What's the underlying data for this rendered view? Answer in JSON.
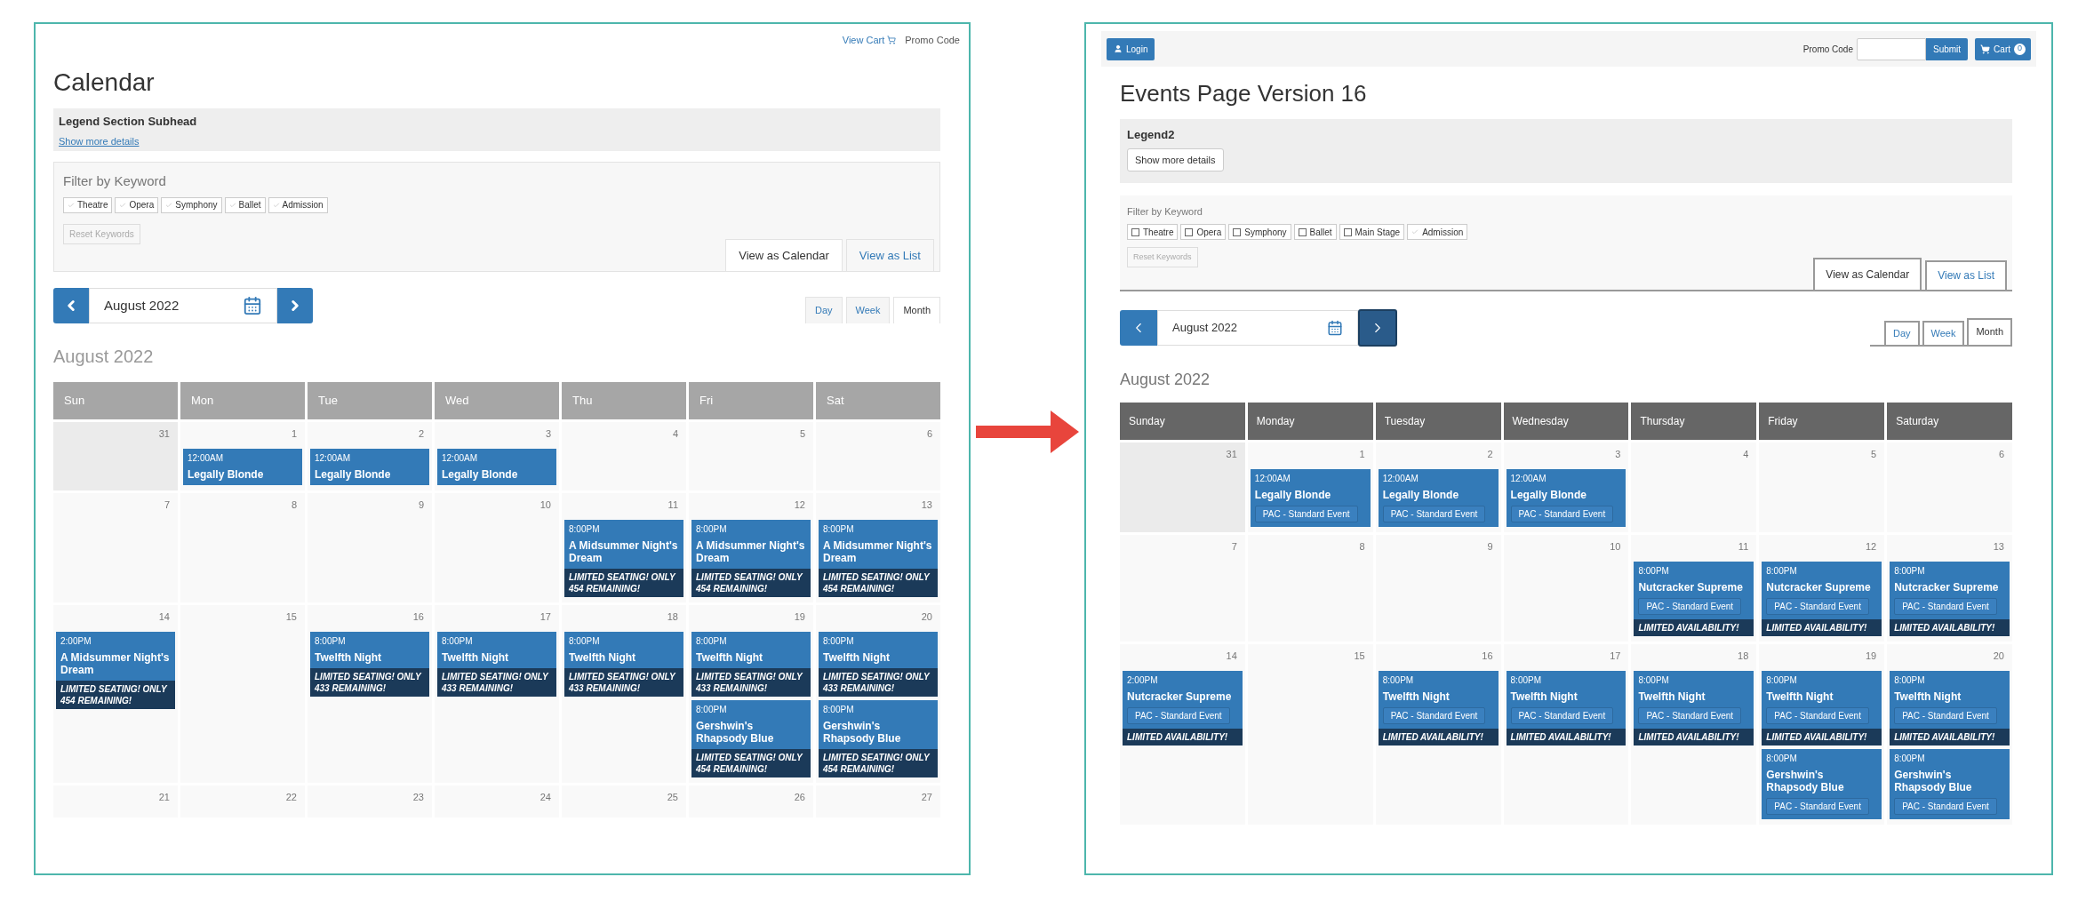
{
  "panels": [
    {
      "kind": "classic",
      "header_links": [
        {
          "kind": "cart",
          "label": "View Cart"
        },
        {
          "kind": "text",
          "label": "Promo Code"
        }
      ],
      "title": "Calendar",
      "legend": {
        "title": "Legend Section Subhead",
        "details": "Show more details"
      },
      "filter": {
        "title": "Filter by Keyword",
        "keywords": [
          {
            "label": "Theatre",
            "checked": true
          },
          {
            "label": "Opera",
            "checked": true
          },
          {
            "label": "Symphony",
            "checked": true
          },
          {
            "label": "Ballet",
            "checked": true
          },
          {
            "label": "Admission",
            "checked": true
          }
        ],
        "reset": "Reset Keywords"
      },
      "view_tabs": [
        {
          "label": "View as Calendar",
          "selected": true
        },
        {
          "label": "View as List",
          "selected": false
        }
      ],
      "month_picker": {
        "value": "August 2022",
        "next_focused": false
      },
      "range_tabs": [
        {
          "label": "Day",
          "selected": false
        },
        {
          "label": "Week",
          "selected": false
        },
        {
          "label": "Month",
          "selected": true
        }
      ],
      "month_heading": "August 2022",
      "weekdays": [
        "Sun",
        "Mon",
        "Tue",
        "Wed",
        "Thu",
        "Fri",
        "Sat"
      ],
      "weeks": [
        [
          {
            "day": "31",
            "outside": true
          },
          {
            "day": "1",
            "outside": false,
            "events": [
              {
                "time": "12:00AM",
                "title": "Legally Blonde"
              }
            ]
          },
          {
            "day": "2",
            "outside": false,
            "events": [
              {
                "time": "12:00AM",
                "title": "Legally Blonde"
              }
            ]
          },
          {
            "day": "3",
            "outside": false,
            "events": [
              {
                "time": "12:00AM",
                "title": "Legally Blonde"
              }
            ]
          },
          {
            "day": "4",
            "outside": false
          },
          {
            "day": "5",
            "outside": false
          },
          {
            "day": "6",
            "outside": false
          }
        ],
        [
          {
            "day": "7",
            "outside": false
          },
          {
            "day": "8",
            "outside": false
          },
          {
            "day": "9",
            "outside": false
          },
          {
            "day": "10",
            "outside": false
          },
          {
            "day": "11",
            "outside": false,
            "events": [
              {
                "time": "8:00PM",
                "title": "A Midsummer Night's Dream",
                "note": "LIMITED SEATING! ONLY 454 REMAINING!"
              }
            ]
          },
          {
            "day": "12",
            "outside": false,
            "events": [
              {
                "time": "8:00PM",
                "title": "A Midsummer Night's Dream",
                "note": "LIMITED SEATING! ONLY 454 REMAINING!"
              }
            ]
          },
          {
            "day": "13",
            "outside": false,
            "events": [
              {
                "time": "8:00PM",
                "title": "A Midsummer Night's Dream",
                "note": "LIMITED SEATING! ONLY 454 REMAINING!"
              }
            ]
          }
        ],
        [
          {
            "day": "14",
            "outside": false,
            "events": [
              {
                "time": "2:00PM",
                "title": "A Midsummer Night's Dream",
                "note": "LIMITED SEATING! ONLY 454 REMAINING!"
              }
            ]
          },
          {
            "day": "15",
            "outside": false
          },
          {
            "day": "16",
            "outside": false,
            "events": [
              {
                "time": "8:00PM",
                "title": "Twelfth Night",
                "note": "LIMITED SEATING! ONLY 433 REMAINING!"
              }
            ]
          },
          {
            "day": "17",
            "outside": false,
            "events": [
              {
                "time": "8:00PM",
                "title": "Twelfth Night",
                "note": "LIMITED SEATING! ONLY 433 REMAINING!"
              }
            ]
          },
          {
            "day": "18",
            "outside": false,
            "events": [
              {
                "time": "8:00PM",
                "title": "Twelfth Night",
                "note": "LIMITED SEATING! ONLY 433 REMAINING!"
              }
            ]
          },
          {
            "day": "19",
            "outside": false,
            "events": [
              {
                "time": "8:00PM",
                "title": "Twelfth Night",
                "note": "LIMITED SEATING! ONLY 433 REMAINING!"
              },
              {
                "time": "8:00PM",
                "title": "Gershwin's Rhapsody Blue",
                "note": "LIMITED SEATING! ONLY 454 REMAINING!"
              }
            ]
          },
          {
            "day": "20",
            "outside": false,
            "events": [
              {
                "time": "8:00PM",
                "title": "Twelfth Night",
                "note": "LIMITED SEATING! ONLY 433 REMAINING!"
              },
              {
                "time": "8:00PM",
                "title": "Gershwin's Rhapsody Blue",
                "note": "LIMITED SEATING! ONLY 454 REMAINING!"
              }
            ]
          }
        ],
        [
          {
            "day": "21",
            "outside": false
          },
          {
            "day": "22",
            "outside": false
          },
          {
            "day": "23",
            "outside": false
          },
          {
            "day": "24",
            "outside": false
          },
          {
            "day": "25",
            "outside": false
          },
          {
            "day": "26",
            "outside": false
          },
          {
            "day": "27",
            "outside": false
          }
        ]
      ]
    },
    {
      "kind": "modern",
      "toolbar": {
        "login": "Login",
        "promo_label": "Promo Code",
        "submit": "Submit",
        "cart": "Cart",
        "cart_count": "0"
      },
      "title": "Events Page Version 16",
      "legend": {
        "title": "Legend2",
        "details": "Show more details"
      },
      "filter": {
        "title": "Filter by Keyword",
        "keywords": [
          {
            "label": "Theatre",
            "checked": false
          },
          {
            "label": "Opera",
            "checked": false
          },
          {
            "label": "Symphony",
            "checked": false
          },
          {
            "label": "Ballet",
            "checked": false
          },
          {
            "label": "Main Stage",
            "checked": false
          },
          {
            "label": "Admission",
            "checked": true
          }
        ],
        "reset": "Reset Keywords"
      },
      "view_tabs": [
        {
          "label": "View as Calendar",
          "selected": true
        },
        {
          "label": "View as List",
          "selected": false
        }
      ],
      "month_picker": {
        "value": "August 2022",
        "next_focused": true
      },
      "range_tabs": [
        {
          "label": "Day",
          "selected": false
        },
        {
          "label": "Week",
          "selected": false
        },
        {
          "label": "Month",
          "selected": true
        }
      ],
      "month_heading": "August 2022",
      "weekdays": [
        "Sunday",
        "Monday",
        "Tuesday",
        "Wednesday",
        "Thursday",
        "Friday",
        "Saturday"
      ],
      "weeks": [
        [
          {
            "day": "31",
            "outside": true
          },
          {
            "day": "1",
            "outside": false,
            "events": [
              {
                "time": "12:00AM",
                "title": "Legally Blonde",
                "tag": "PAC - Standard Event"
              }
            ]
          },
          {
            "day": "2",
            "outside": false,
            "events": [
              {
                "time": "12:00AM",
                "title": "Legally Blonde",
                "tag": "PAC - Standard Event"
              }
            ]
          },
          {
            "day": "3",
            "outside": false,
            "events": [
              {
                "time": "12:00AM",
                "title": "Legally Blonde",
                "tag": "PAC - Standard Event"
              }
            ]
          },
          {
            "day": "4",
            "outside": false
          },
          {
            "day": "5",
            "outside": false
          },
          {
            "day": "6",
            "outside": false
          }
        ],
        [
          {
            "day": "7",
            "outside": false
          },
          {
            "day": "8",
            "outside": false
          },
          {
            "day": "9",
            "outside": false
          },
          {
            "day": "10",
            "outside": false
          },
          {
            "day": "11",
            "outside": false,
            "events": [
              {
                "time": "8:00PM",
                "title": "Nutcracker Supreme",
                "tag": "PAC - Standard Event",
                "note": "LIMITED AVAILABILITY!"
              }
            ]
          },
          {
            "day": "12",
            "outside": false,
            "events": [
              {
                "time": "8:00PM",
                "title": "Nutcracker Supreme",
                "tag": "PAC - Standard Event",
                "note": "LIMITED AVAILABILITY!"
              }
            ]
          },
          {
            "day": "13",
            "outside": false,
            "events": [
              {
                "time": "8:00PM",
                "title": "Nutcracker Supreme",
                "tag": "PAC - Standard Event",
                "note": "LIMITED AVAILABILITY!"
              }
            ]
          }
        ],
        [
          {
            "day": "14",
            "outside": false,
            "events": [
              {
                "time": "2:00PM",
                "title": "Nutcracker Supreme",
                "tag": "PAC - Standard Event",
                "note": "LIMITED AVAILABILITY!"
              }
            ]
          },
          {
            "day": "15",
            "outside": false
          },
          {
            "day": "16",
            "outside": false,
            "events": [
              {
                "time": "8:00PM",
                "title": "Twelfth Night",
                "tag": "PAC - Standard Event",
                "note": "LIMITED AVAILABILITY!"
              }
            ]
          },
          {
            "day": "17",
            "outside": false,
            "events": [
              {
                "time": "8:00PM",
                "title": "Twelfth Night",
                "tag": "PAC - Standard Event",
                "note": "LIMITED AVAILABILITY!"
              }
            ]
          },
          {
            "day": "18",
            "outside": false,
            "events": [
              {
                "time": "8:00PM",
                "title": "Twelfth Night",
                "tag": "PAC - Standard Event",
                "note": "LIMITED AVAILABILITY!"
              }
            ]
          },
          {
            "day": "19",
            "outside": false,
            "events": [
              {
                "time": "8:00PM",
                "title": "Twelfth Night",
                "tag": "PAC - Standard Event",
                "note": "LIMITED AVAILABILITY!"
              },
              {
                "time": "8:00PM",
                "title": "Gershwin's Rhapsody Blue",
                "tag": "PAC - Standard Event"
              }
            ]
          },
          {
            "day": "20",
            "outside": false,
            "events": [
              {
                "time": "8:00PM",
                "title": "Twelfth Night",
                "tag": "PAC - Standard Event",
                "note": "LIMITED AVAILABILITY!"
              },
              {
                "time": "8:00PM",
                "title": "Gershwin's Rhapsody Blue",
                "tag": "PAC - Standard Event"
              }
            ]
          }
        ]
      ]
    }
  ]
}
